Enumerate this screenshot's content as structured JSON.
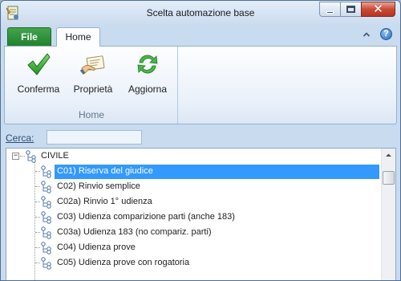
{
  "window": {
    "title": "Scelta automazione base",
    "close_glyph": "✕"
  },
  "ribbon": {
    "tabs": [
      {
        "label": "File"
      },
      {
        "label": "Home"
      }
    ],
    "help_glyph": "?",
    "collapse_glyph": "^",
    "groups": [
      {
        "label": "Home",
        "buttons": [
          {
            "label": "Conferma",
            "icon": "checkmark-icon"
          },
          {
            "label": "Proprietà",
            "icon": "properties-icon"
          },
          {
            "label": "Aggiorna",
            "icon": "refresh-icon"
          }
        ]
      }
    ]
  },
  "search": {
    "label": "Cerca:",
    "value": "",
    "placeholder": ""
  },
  "tree": {
    "root": {
      "label": "CIVILE",
      "expander": "−",
      "expanded": true
    },
    "items": [
      {
        "label": "C01) Riserva del giudice",
        "selected": true
      },
      {
        "label": "C02) Rinvio semplice",
        "selected": false
      },
      {
        "label": "C02a) Rinvio 1° udienza",
        "selected": false
      },
      {
        "label": "C03) Udienza comparizione parti (anche 183)",
        "selected": false
      },
      {
        "label": "C03a) Udienza 183 (no compariz. parti)",
        "selected": false
      },
      {
        "label": "C04) Udienza prove",
        "selected": false
      },
      {
        "label": "C05) Udienza prove con rogatoria",
        "selected": false
      }
    ]
  },
  "colors": {
    "selection": "#3399ff",
    "file_tab": "#2f9a3d",
    "window_frame": "#c9dbee"
  }
}
